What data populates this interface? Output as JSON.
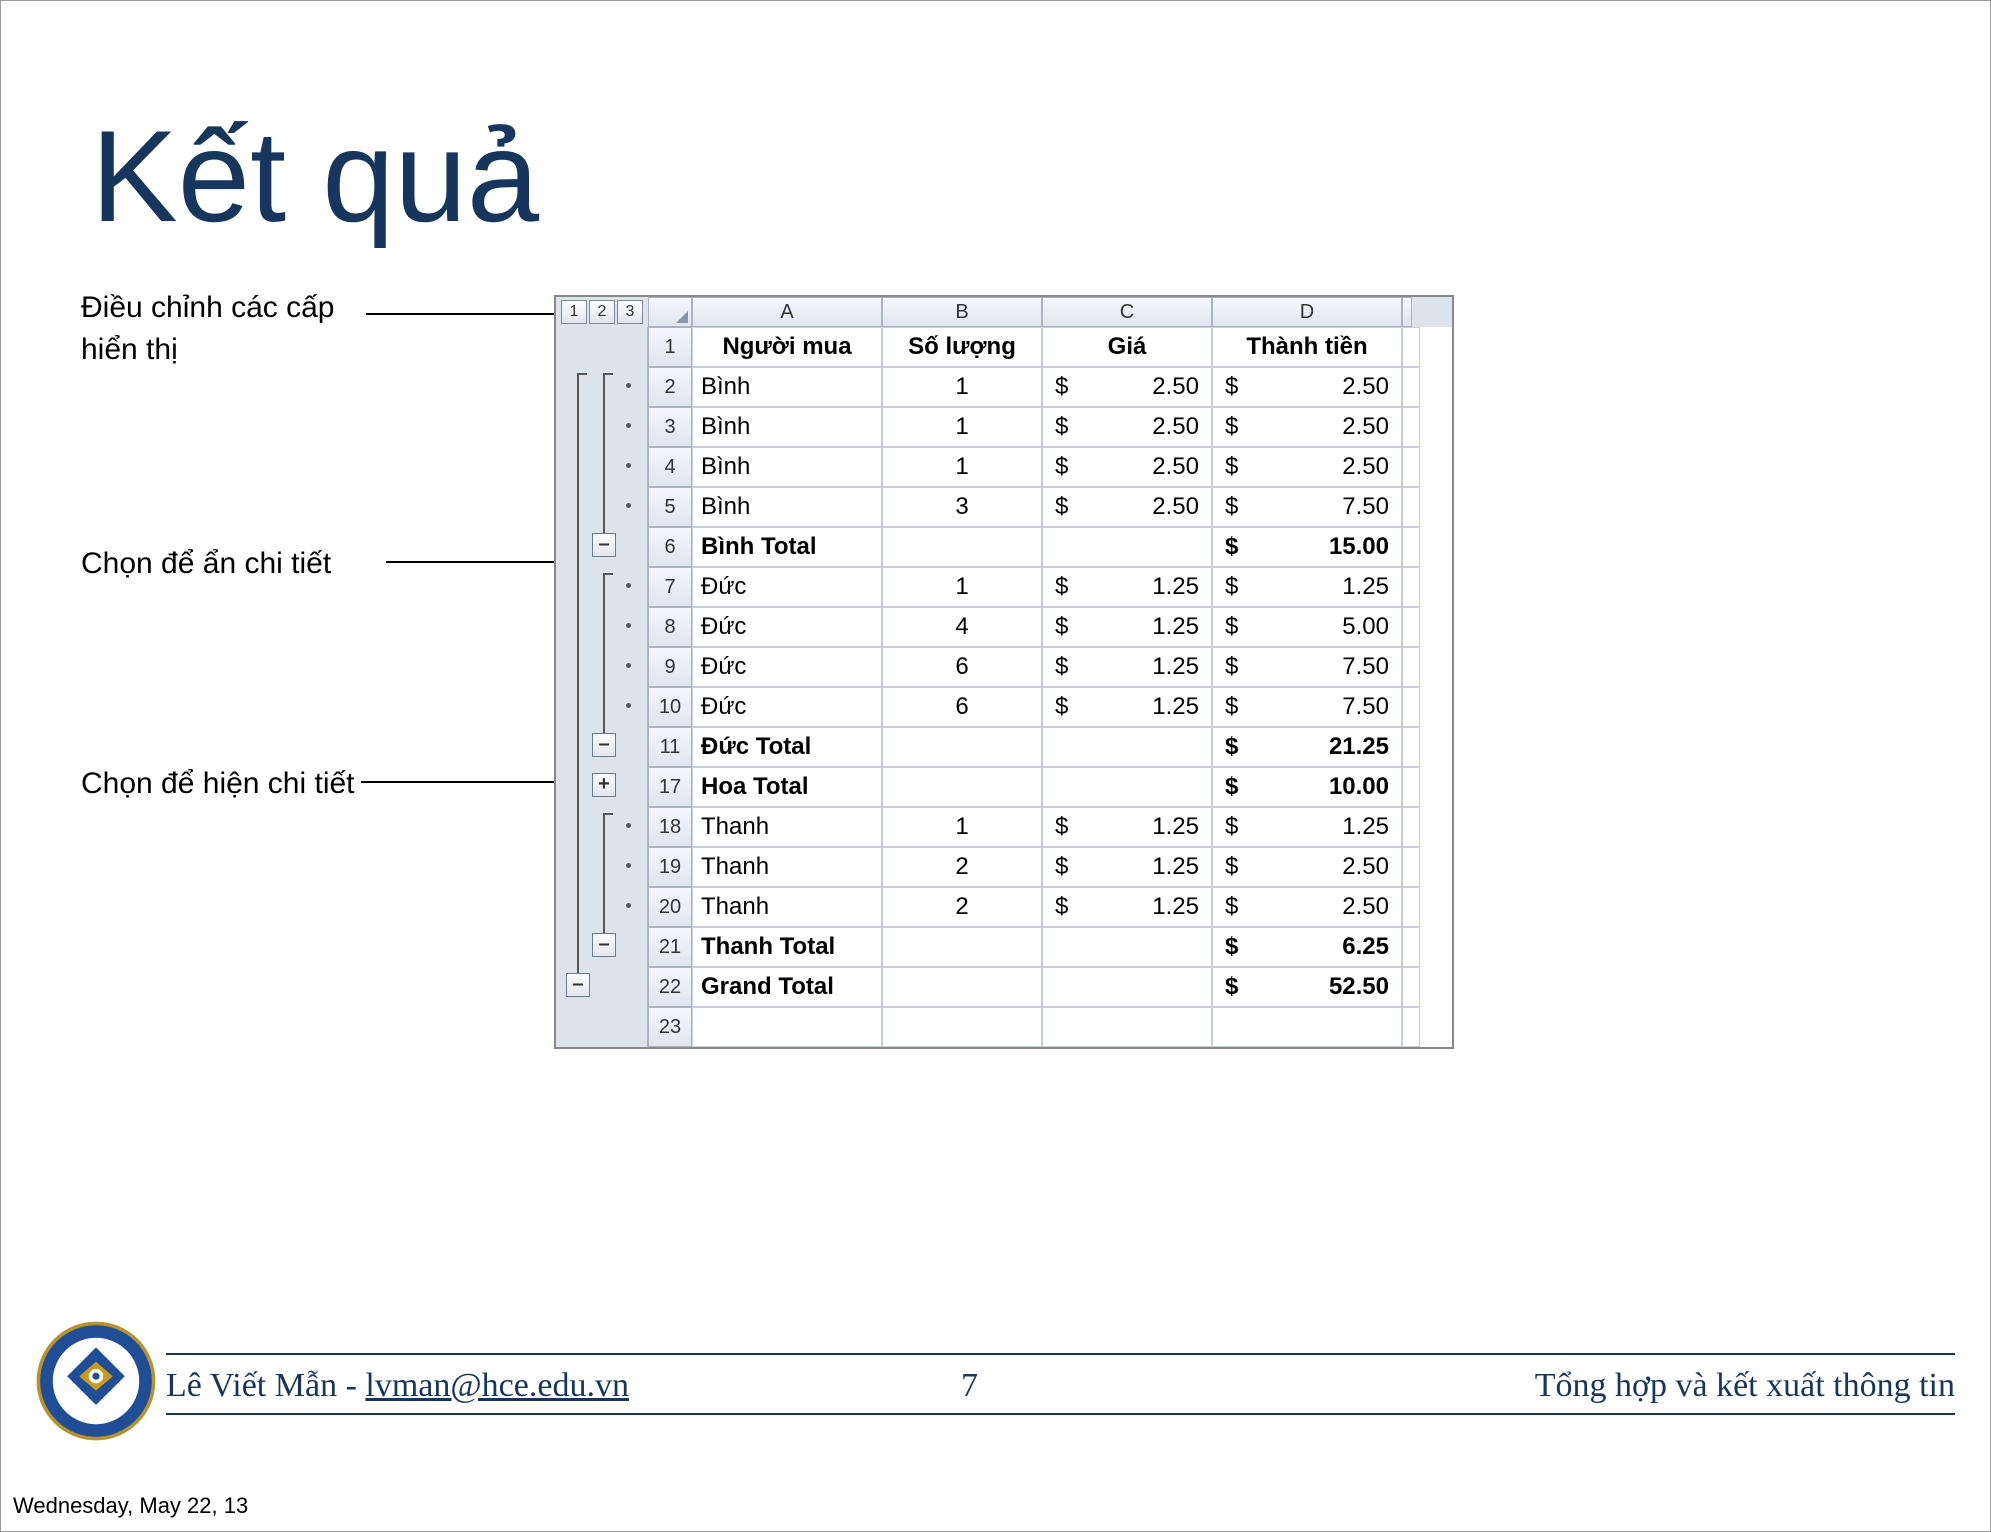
{
  "title": "Kết quả",
  "annotations": {
    "levels": "Điều chỉnh các cấp hiển thị",
    "collapse": "Chọn để ẩn chi tiết",
    "expand": "Chọn để hiện chi tiết"
  },
  "outline_levels": [
    "1",
    "2",
    "3"
  ],
  "columns": [
    "A",
    "B",
    "C",
    "D"
  ],
  "headers": {
    "a": "Người mua",
    "b": "Số lượng",
    "c": "Giá",
    "d": "Thành tiền"
  },
  "rows": [
    {
      "n": "1",
      "a": "Người mua",
      "b": "Số lượng",
      "c": "Giá",
      "d": "Thành tiền",
      "type": "header"
    },
    {
      "n": "2",
      "a": "Bình",
      "b": "1",
      "c": "2.50",
      "d": "2.50",
      "type": "data"
    },
    {
      "n": "3",
      "a": "Bình",
      "b": "1",
      "c": "2.50",
      "d": "2.50",
      "type": "data"
    },
    {
      "n": "4",
      "a": "Bình",
      "b": "1",
      "c": "2.50",
      "d": "2.50",
      "type": "data"
    },
    {
      "n": "5",
      "a": "Bình",
      "b": "3",
      "c": "2.50",
      "d": "7.50",
      "type": "data"
    },
    {
      "n": "6",
      "a": "Bình Total",
      "b": "",
      "c": "",
      "d": "15.00",
      "type": "total"
    },
    {
      "n": "7",
      "a": "Đức",
      "b": "1",
      "c": "1.25",
      "d": "1.25",
      "type": "data"
    },
    {
      "n": "8",
      "a": "Đức",
      "b": "4",
      "c": "1.25",
      "d": "5.00",
      "type": "data"
    },
    {
      "n": "9",
      "a": "Đức",
      "b": "6",
      "c": "1.25",
      "d": "7.50",
      "type": "data"
    },
    {
      "n": "10",
      "a": "Đức",
      "b": "6",
      "c": "1.25",
      "d": "7.50",
      "type": "data"
    },
    {
      "n": "11",
      "a": "Đức Total",
      "b": "",
      "c": "",
      "d": "21.25",
      "type": "total"
    },
    {
      "n": "17",
      "a": "Hoa Total",
      "b": "",
      "c": "",
      "d": "10.00",
      "type": "total"
    },
    {
      "n": "18",
      "a": "Thanh",
      "b": "1",
      "c": "1.25",
      "d": "1.25",
      "type": "data"
    },
    {
      "n": "19",
      "a": "Thanh",
      "b": "2",
      "c": "1.25",
      "d": "2.50",
      "type": "data"
    },
    {
      "n": "20",
      "a": "Thanh",
      "b": "2",
      "c": "1.25",
      "d": "2.50",
      "type": "data"
    },
    {
      "n": "21",
      "a": "Thanh Total",
      "b": "",
      "c": "",
      "d": "6.25",
      "type": "total"
    },
    {
      "n": "22",
      "a": "Grand Total",
      "b": "",
      "c": "",
      "d": "52.50",
      "type": "grand"
    },
    {
      "n": "23",
      "a": "",
      "b": "",
      "c": "",
      "d": "",
      "type": "empty"
    }
  ],
  "outline_symbols": {
    "minus": "–",
    "plus": "+"
  },
  "footer": {
    "author": "Lê Viết Mẫn - ",
    "email": "lvman@hce.edu.vn",
    "page": "7",
    "topic": "Tổng hợp và kết xuất thông tin"
  },
  "date": "Wednesday, May 22, 13"
}
